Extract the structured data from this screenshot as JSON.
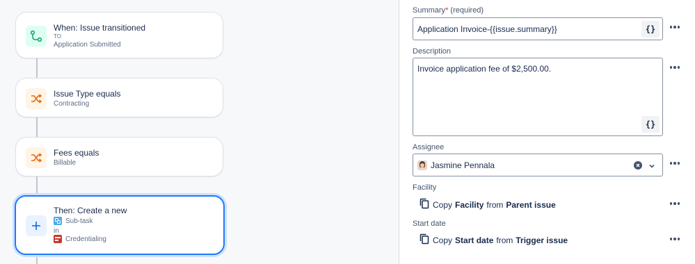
{
  "rule": {
    "trigger": {
      "title": "When: Issue transitioned",
      "to_label": "TO",
      "status": "Application Submitted"
    },
    "condition1": {
      "title": "Issue Type equals",
      "value": "Contracting"
    },
    "condition2": {
      "title": "Fees equals",
      "value": "Billable"
    },
    "action": {
      "title": "Then: Create a new",
      "issue_type": "Sub-task",
      "in_label": "in",
      "project": "Credentialing"
    }
  },
  "form": {
    "summary": {
      "label": "Summary",
      "required_mark": "*",
      "required_text": "(required)",
      "value": "Application Invoice-{{issue.summary}}"
    },
    "description": {
      "label": "Description",
      "value": "Invoice application fee of $2,500.00."
    },
    "assignee": {
      "label": "Assignee",
      "value": "Jasmine Pennala"
    },
    "facility": {
      "label": "Facility",
      "copy": "Copy",
      "field": "Facility",
      "from": "from",
      "source": "Parent issue"
    },
    "start_date": {
      "label": "Start date",
      "copy": "Copy",
      "field": "Start date",
      "from": "from",
      "source": "Trigger issue"
    },
    "smart_value_button": "{}"
  },
  "colors": {
    "accent": "#1d7afc",
    "trigger_icon": "#22a06b",
    "condition_icon": "#e56910",
    "action_icon": "#0c66e4"
  }
}
